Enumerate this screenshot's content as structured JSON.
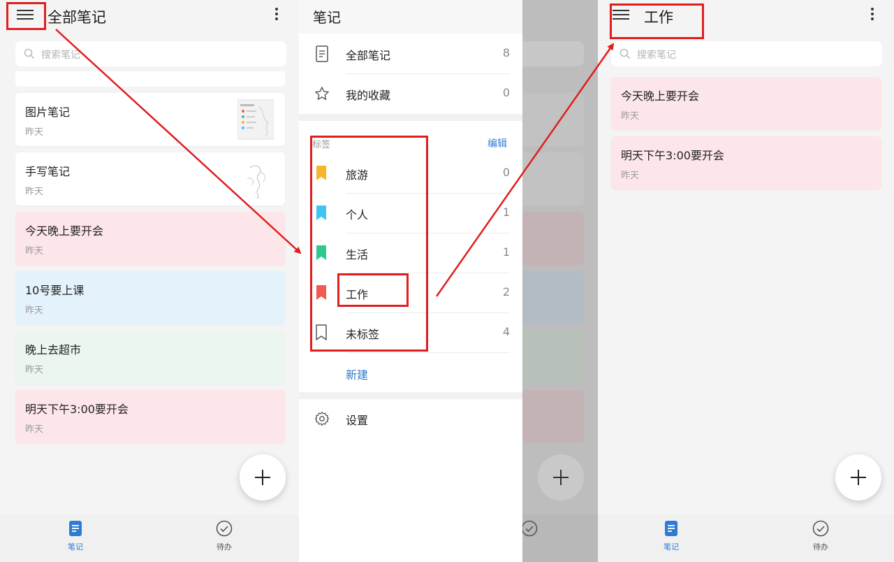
{
  "colors": {
    "pink_card": "#fde6e9",
    "blue_card": "#e4f2fb",
    "green_card": "#eaf6ee",
    "white_card": "#ffffff",
    "accent_blue": "#2f7bd3",
    "annotation_red": "#e01e1e",
    "tag_yellow": "#f7b52c",
    "tag_cyan": "#3ec6f0",
    "tag_green": "#2ec98e",
    "tag_red": "#f25a4f"
  },
  "panel1": {
    "title": "全部笔记",
    "search_placeholder": "搜索笔记",
    "notes": [
      {
        "title": "图片笔记",
        "date": "昨天",
        "bg": "white",
        "thumb": "image-thumbnail"
      },
      {
        "title": "手写笔记",
        "date": "昨天",
        "bg": "white",
        "thumb": "handwriting-thumbnail"
      },
      {
        "title": "今天晚上要开会",
        "date": "昨天",
        "bg": "pink"
      },
      {
        "title": "10号要上课",
        "date": "昨天",
        "bg": "blue"
      },
      {
        "title": "晚上去超市",
        "date": "昨天",
        "bg": "green"
      },
      {
        "title": "明天下午3:00要开会",
        "date": "昨天",
        "bg": "pink"
      }
    ],
    "bottom_tabs": [
      {
        "label": "笔记",
        "icon": "note-icon",
        "active": true
      },
      {
        "label": "待办",
        "icon": "todo-check-icon",
        "active": false
      }
    ]
  },
  "drawer": {
    "title": "笔记",
    "items": [
      {
        "label": "全部笔记",
        "count": "8",
        "icon": "document-icon"
      },
      {
        "label": "我的收藏",
        "count": "0",
        "icon": "star-icon"
      }
    ],
    "tags_label": "标签",
    "edit_label": "编辑",
    "tags": [
      {
        "label": "旅游",
        "count": "0",
        "color": "#f7b52c"
      },
      {
        "label": "个人",
        "count": "1",
        "color": "#3ec6f0"
      },
      {
        "label": "生活",
        "count": "1",
        "color": "#2ec98e"
      },
      {
        "label": "工作",
        "count": "2",
        "color": "#f25a4f"
      },
      {
        "label": "未标签",
        "count": "4",
        "color": "outline"
      }
    ],
    "new_label": "新建",
    "settings_label": "设置"
  },
  "panel3": {
    "title": "工作",
    "search_placeholder": "搜索笔记",
    "notes": [
      {
        "title": "今天晚上要开会",
        "date": "昨天",
        "bg": "pink"
      },
      {
        "title": "明天下午3:00要开会",
        "date": "昨天",
        "bg": "pink"
      }
    ],
    "bottom_tabs": [
      {
        "label": "笔记",
        "icon": "note-icon",
        "active": true
      },
      {
        "label": "待办",
        "icon": "todo-check-icon",
        "active": false
      }
    ]
  }
}
